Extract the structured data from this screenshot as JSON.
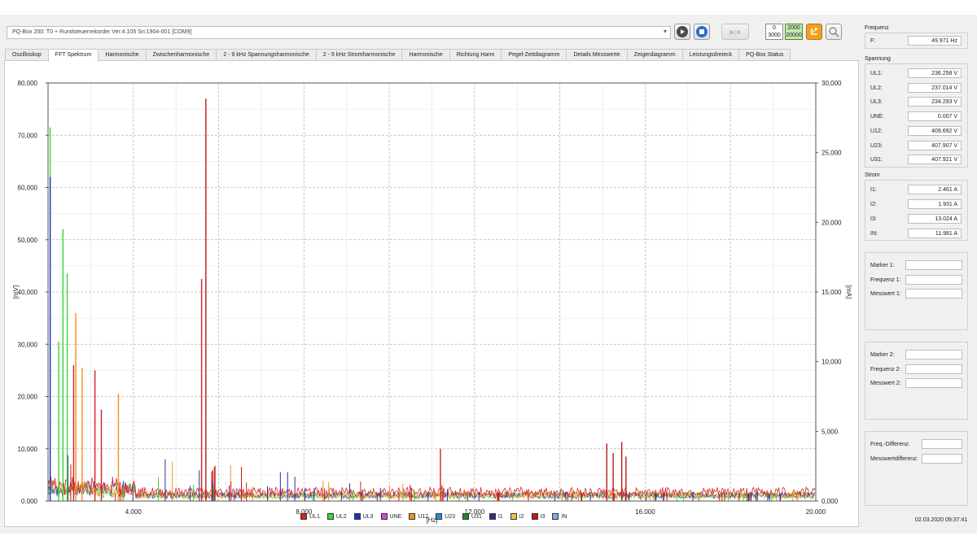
{
  "device": {
    "label": "PQ-Box 200: T0  + Rundsteuerrekorder Ver:4.105 Sn:1904-001 [COM9]"
  },
  "toolbar": {
    "play_icon": "play-icon",
    "stop_icon": "stop-icon",
    "record_label": "▶|■",
    "range1_top": "0",
    "range1_bottom": "3000",
    "range2_top": "2000",
    "range2_bottom": "20000",
    "export_icon": "export-icon",
    "search_icon": "search-icon"
  },
  "tabs": [
    "Oszilloskop",
    "FFT Spektrum",
    "Harmonische",
    "Zwischenharmonische",
    "2 - 9 kHz Spannungsharmonische",
    "2 - 9 kHz Stromharmonische",
    "Harmonische",
    "Richtung Harm",
    "Pegel-Zeitdiagramm",
    "Details Messwerte",
    "Zeigerdiagramm",
    "Leistungsdreieck",
    "PQ-Box Status"
  ],
  "active_tab": "FFT Spektrum",
  "chart_data": {
    "type": "line",
    "xlabel": "[Hz]",
    "ylabel": "[mV]",
    "y2label": "[mA]",
    "xlim": [
      2000,
      20000
    ],
    "ylim": [
      0,
      80000
    ],
    "y2lim": [
      0,
      30000
    ],
    "x_ticks": [
      "4.000",
      "8.000",
      "12.000",
      "16.000",
      "20.000"
    ],
    "y_ticks": [
      "0.000",
      "10,000",
      "20,000",
      "30,000",
      "40,000",
      "50,000",
      "60,000",
      "70,000",
      "80,000"
    ],
    "y2_ticks": [
      "0,000",
      "5,000",
      "10,000",
      "15,000",
      "20,000",
      "25,000",
      "30,000"
    ],
    "grid": true,
    "legend_position": "bottom",
    "series": [
      {
        "name": "UL1",
        "color": "#d42020"
      },
      {
        "name": "UL2",
        "color": "#3ad43a"
      },
      {
        "name": "UL3",
        "color": "#1a2fd0"
      },
      {
        "name": "UNE",
        "color": "#e040e0"
      },
      {
        "name": "U12",
        "color": "#f09020"
      },
      {
        "name": "U23",
        "color": "#2090e0"
      },
      {
        "name": "U31",
        "color": "#1e8a2e"
      },
      {
        "name": "I1",
        "color": "#3a2a8a"
      },
      {
        "name": "I2",
        "color": "#f0c040"
      },
      {
        "name": "I3",
        "color": "#c01818"
      },
      {
        "name": "IN",
        "color": "#70b0f0"
      }
    ],
    "peaks": [
      {
        "series": "UL2",
        "x": 2050,
        "y": 71500
      },
      {
        "series": "UL3",
        "x": 2050,
        "y": 62000
      },
      {
        "series": "UL2",
        "x": 2250,
        "y": 30500
      },
      {
        "series": "UL2",
        "x": 2350,
        "y": 52000
      },
      {
        "series": "UL2",
        "x": 2450,
        "y": 43500
      },
      {
        "series": "U12",
        "x": 2650,
        "y": 36000
      },
      {
        "series": "UL1",
        "x": 2600,
        "y": 26000
      },
      {
        "series": "U12",
        "x": 2800,
        "y": 25500
      },
      {
        "series": "UL1",
        "x": 3100,
        "y": 25000
      },
      {
        "series": "UL1",
        "x": 3250,
        "y": 17500
      },
      {
        "series": "U12",
        "x": 3650,
        "y": 20500
      },
      {
        "series": "UL1",
        "x": 5600,
        "y": 42500
      },
      {
        "series": "I3",
        "x": 5700,
        "y": 77000
      },
      {
        "series": "UL1",
        "x": 11200,
        "y": 10000
      },
      {
        "series": "I3",
        "x": 15100,
        "y": 11000
      },
      {
        "series": "I3",
        "x": 15250,
        "y": 9200
      },
      {
        "series": "I3",
        "x": 15450,
        "y": 11300
      },
      {
        "series": "I3",
        "x": 15550,
        "y": 8500
      }
    ]
  },
  "right_panel": {
    "frequency_title": "Frequenz",
    "f_label": "F:",
    "f_value": "49.971 Hz",
    "voltage_title": "Spannung",
    "voltages": [
      {
        "label": "UL1:",
        "value": "236.258 V"
      },
      {
        "label": "UL2:",
        "value": "237.014 V"
      },
      {
        "label": "UL3:",
        "value": "234.293 V"
      },
      {
        "label": "UNE:",
        "value": "0.007 V"
      },
      {
        "label": "U12:",
        "value": "409.692 V"
      },
      {
        "label": "U23:",
        "value": "407.907 V"
      },
      {
        "label": "U31:",
        "value": "407.921 V"
      }
    ],
    "current_title": "Strom",
    "currents": [
      {
        "label": "I1:",
        "value": "2.461 A"
      },
      {
        "label": "I2:",
        "value": "1.931 A"
      },
      {
        "label": "I3:",
        "value": "13.024 A"
      },
      {
        "label": "IN:",
        "value": "11.981 A"
      }
    ],
    "marker1": [
      "Marker 1:",
      "Frequenz 1:",
      "Messwert 1:"
    ],
    "marker2": [
      "Marker 2:",
      "Frequenz 2:",
      "Messwert 2:"
    ],
    "diff": [
      "Freq.-Differenz:",
      "Messwertdifferenz:"
    ]
  },
  "timestamp": "02.03.2020 09:37:41"
}
